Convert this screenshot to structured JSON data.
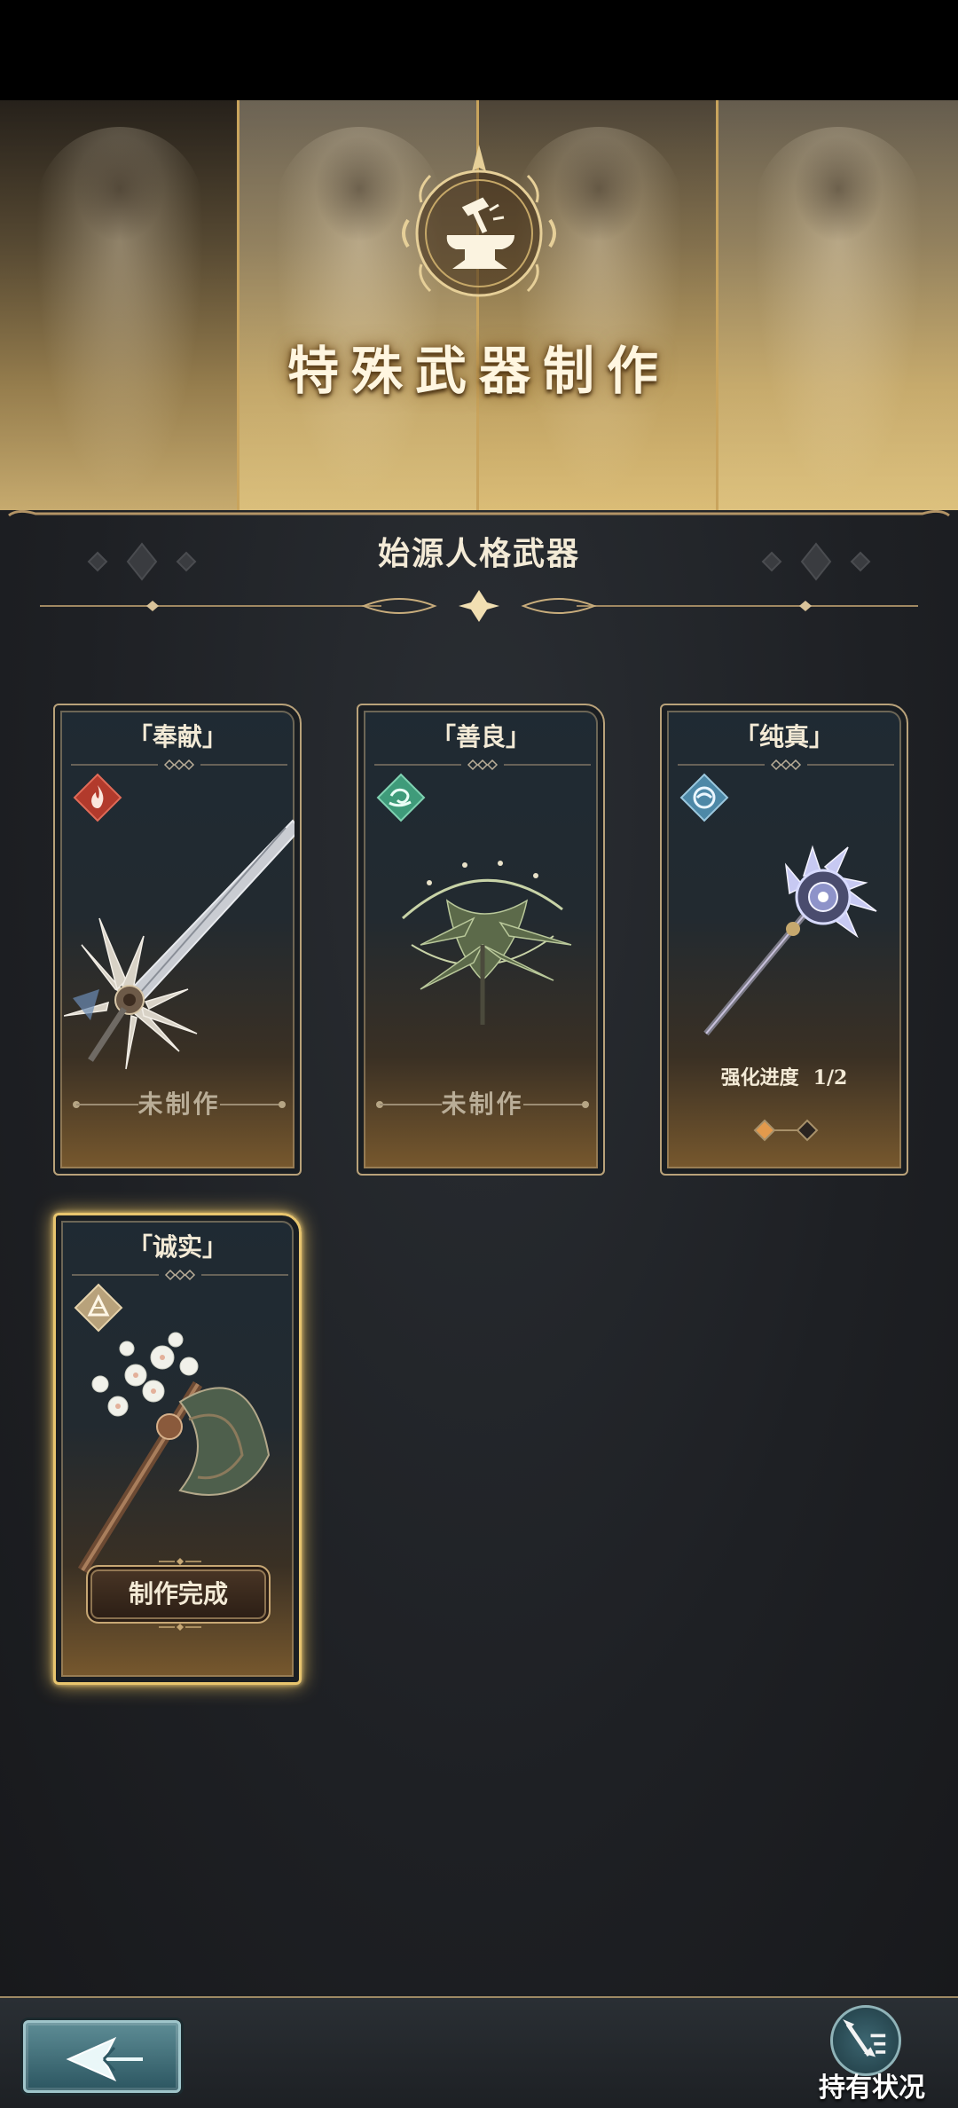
{
  "banner": {
    "title": "特殊武器制作"
  },
  "section": {
    "title": "始源人格武器"
  },
  "weapons": [
    {
      "name": "「奉献」",
      "element": "fire-element",
      "status": "未制作"
    },
    {
      "name": "「善良」",
      "element": "wind-element",
      "status": "未制作"
    },
    {
      "name": "「纯真」",
      "element": "water-element",
      "progress_label": "强化进度",
      "progress_value": "1/2",
      "progress_filled": 1,
      "progress_total": 2
    },
    {
      "name": "「诚实」",
      "element": "earth-element",
      "status": "制作完成",
      "selected": true
    }
  ],
  "footer": {
    "holdings_label": "持有状况"
  },
  "icons": [
    "anvil-hammer-icon",
    "fire-element-icon",
    "wind-element-icon",
    "water-element-icon",
    "earth-element-icon",
    "back-arrow-icon",
    "holdings-list-icon"
  ],
  "colors": {
    "accent_gold": "#e8c56e",
    "fire": "#b23a2c",
    "wind": "#3f9b7a",
    "water": "#4d88a7",
    "earth": "#b8a27b",
    "progress_filled": "#e39a4c"
  }
}
